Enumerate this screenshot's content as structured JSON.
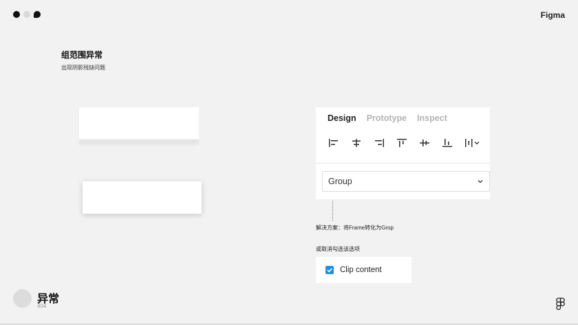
{
  "brand": "Figma",
  "heading": "组范围异常",
  "subheading": "出现阴影残缺问题",
  "panel": {
    "tabs": [
      "Design",
      "Prototype",
      "Inspect"
    ],
    "active_tab": "Design",
    "align_icons": [
      "align-left-icon",
      "align-horizontal-center-icon",
      "align-right-icon",
      "align-top-icon",
      "align-vertical-center-icon",
      "align-bottom-icon",
      "distribute-spacing-icon"
    ],
    "select_value": "Group"
  },
  "solution_text": "解决方案：将Frame转化为Grop",
  "alternative_text": "或取消勾选该选项",
  "clip_content": {
    "label": "Clip content",
    "checked": true
  },
  "footer": {
    "title": "异常",
    "code": "404"
  },
  "colors": {
    "accent": "#1c8fe6",
    "background": "#f2f2f2"
  }
}
